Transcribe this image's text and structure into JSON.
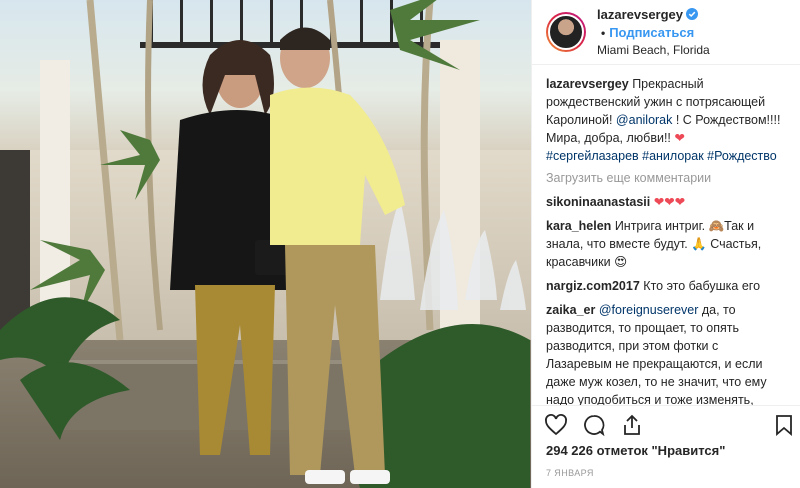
{
  "header": {
    "username": "lazarevsergey",
    "verified_icon": "verified-badge-icon",
    "follow_label": "Подписаться",
    "location": "Miami Beach, Florida"
  },
  "caption": {
    "username": "lazarevsergey",
    "text_parts": [
      "Прекрасный рождественский ужин с потрясающей Каролиной! ",
      "@anilorak",
      " ! С Рождеством!!!! Мира, добра, любви!! ",
      "❤"
    ],
    "hashtags": "#сергейлазарев #анилорак #Рождество"
  },
  "load_more_label": "Загрузить еще комментарии",
  "comments": [
    {
      "username": "sikoninaanastasii",
      "text": "❤❤❤"
    },
    {
      "username": "kara_helen",
      "text": "Интрига интриг. 🙈Так и знала, что вместе будут. 🙏 Счастья, красавчики 😍"
    },
    {
      "username": "nargiz.com2017",
      "text": "Кто это бабушка его"
    },
    {
      "username": "zaika_er",
      "mention": "@foreignuserever",
      "text": " да, то разводится, то прощает, то опять разводится, при этом фотки с Лазаревым не прекращаются, и если даже муж козел, то не значит, что ему надо уподобиться и тоже изменять, женщина должна достойно себя вести, тем более она публичная личность!"
    }
  ],
  "actions": {
    "like_icon": "heart-icon",
    "comment_icon": "comment-icon",
    "share_icon": "share-icon",
    "save_icon": "bookmark-icon"
  },
  "likes_text": "294 226 отметок \"Нравится\"",
  "date_text": "7 января",
  "colors": {
    "accent": "#3897f0",
    "heart": "#ed4956",
    "muted": "#999999",
    "text": "#262626"
  }
}
